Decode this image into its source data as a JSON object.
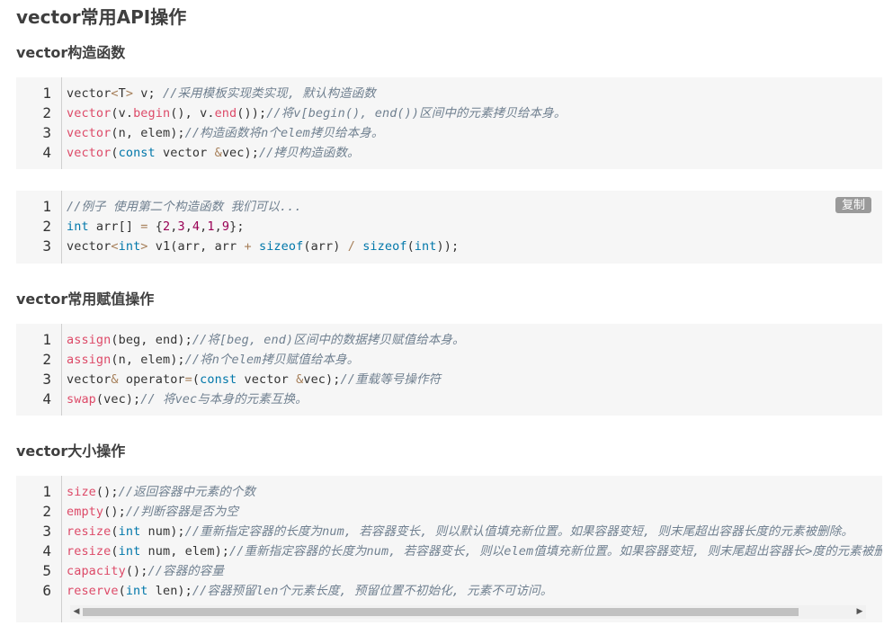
{
  "title": "vector常用API操作",
  "sections": [
    {
      "heading": "vector构造函数"
    },
    {
      "heading": "vector常用赋值操作"
    },
    {
      "heading": "vector大小操作"
    }
  ],
  "copy_label": "复制",
  "blocks": {
    "ctor": [
      {
        "num": "1",
        "tokens": [
          [
            "pl",
            "vector"
          ],
          [
            "op",
            "<"
          ],
          [
            "pl",
            "T"
          ],
          [
            "op",
            ">"
          ],
          [
            "pl",
            " v; "
          ],
          [
            "cm",
            "//采用模板实现类实现, 默认构造函数"
          ]
        ]
      },
      {
        "num": "2",
        "tokens": [
          [
            "fn",
            "vector"
          ],
          [
            "pl",
            "(v."
          ],
          [
            "fn",
            "begin"
          ],
          [
            "pl",
            "(), v."
          ],
          [
            "fn",
            "end"
          ],
          [
            "pl",
            "());"
          ],
          [
            "cm",
            "//将v[begin(), end())区间中的元素拷贝给本身。"
          ]
        ]
      },
      {
        "num": "3",
        "tokens": [
          [
            "fn",
            "vector"
          ],
          [
            "pl",
            "(n, elem);"
          ],
          [
            "cm",
            "//构造函数将n个elem拷贝给本身。"
          ]
        ]
      },
      {
        "num": "4",
        "tokens": [
          [
            "fn",
            "vector"
          ],
          [
            "pl",
            "("
          ],
          [
            "kw",
            "const"
          ],
          [
            "pl",
            " vector "
          ],
          [
            "op",
            "&"
          ],
          [
            "pl",
            "vec);"
          ],
          [
            "cm",
            "//拷贝构造函数。"
          ]
        ]
      }
    ],
    "example": [
      {
        "num": "1",
        "tokens": [
          [
            "cm",
            "//例子 使用第二个构造函数 我们可以..."
          ]
        ]
      },
      {
        "num": "2",
        "tokens": [
          [
            "kw",
            "int"
          ],
          [
            "pl",
            " arr[] "
          ],
          [
            "op",
            "="
          ],
          [
            "pl",
            " {"
          ],
          [
            "num",
            "2"
          ],
          [
            "pl",
            ","
          ],
          [
            "num",
            "3"
          ],
          [
            "pl",
            ","
          ],
          [
            "num",
            "4"
          ],
          [
            "pl",
            ","
          ],
          [
            "num",
            "1"
          ],
          [
            "pl",
            ","
          ],
          [
            "num",
            "9"
          ],
          [
            "pl",
            "};"
          ]
        ]
      },
      {
        "num": "3",
        "tokens": [
          [
            "pl",
            "vector"
          ],
          [
            "op",
            "<"
          ],
          [
            "kw",
            "int"
          ],
          [
            "op",
            ">"
          ],
          [
            "pl",
            " v1(arr, arr "
          ],
          [
            "op",
            "+"
          ],
          [
            "pl",
            " "
          ],
          [
            "kw",
            "sizeof"
          ],
          [
            "pl",
            "(arr) "
          ],
          [
            "op",
            "/"
          ],
          [
            "pl",
            " "
          ],
          [
            "kw",
            "sizeof"
          ],
          [
            "pl",
            "("
          ],
          [
            "kw",
            "int"
          ],
          [
            "pl",
            "));"
          ]
        ]
      }
    ],
    "assign": [
      {
        "num": "1",
        "tokens": [
          [
            "fn",
            "assign"
          ],
          [
            "pl",
            "(beg, end);"
          ],
          [
            "cm",
            "//将[beg, end)区间中的数据拷贝赋值给本身。"
          ]
        ]
      },
      {
        "num": "2",
        "tokens": [
          [
            "fn",
            "assign"
          ],
          [
            "pl",
            "(n, elem);"
          ],
          [
            "cm",
            "//将n个elem拷贝赋值给本身。"
          ]
        ]
      },
      {
        "num": "3",
        "tokens": [
          [
            "pl",
            "vector"
          ],
          [
            "op",
            "&"
          ],
          [
            "pl",
            " operator"
          ],
          [
            "op",
            "="
          ],
          [
            "pl",
            "("
          ],
          [
            "kw",
            "const"
          ],
          [
            "pl",
            " vector  "
          ],
          [
            "op",
            "&"
          ],
          [
            "pl",
            "vec);"
          ],
          [
            "cm",
            "//重载等号操作符"
          ]
        ]
      },
      {
        "num": "4",
        "tokens": [
          [
            "fn",
            "swap"
          ],
          [
            "pl",
            "(vec);"
          ],
          [
            "cm",
            "// 将vec与本身的元素互换。"
          ]
        ]
      }
    ],
    "size": [
      {
        "num": "1",
        "tokens": [
          [
            "fn",
            "size"
          ],
          [
            "pl",
            "();"
          ],
          [
            "cm",
            "//返回容器中元素的个数"
          ]
        ]
      },
      {
        "num": "2",
        "tokens": [
          [
            "fn",
            "empty"
          ],
          [
            "pl",
            "();"
          ],
          [
            "cm",
            "//判断容器是否为空"
          ]
        ]
      },
      {
        "num": "3",
        "tokens": [
          [
            "fn",
            "resize"
          ],
          [
            "pl",
            "("
          ],
          [
            "kw",
            "int"
          ],
          [
            "pl",
            " num);"
          ],
          [
            "cm",
            "//重新指定容器的长度为num, 若容器变长, 则以默认值填充新位置。如果容器变短, 则末尾超出容器长度的元素被删除。"
          ]
        ]
      },
      {
        "num": "4",
        "tokens": [
          [
            "fn",
            "resize"
          ],
          [
            "pl",
            "("
          ],
          [
            "kw",
            "int"
          ],
          [
            "pl",
            " num, elem);"
          ],
          [
            "cm",
            "//重新指定容器的长度为num, 若容器变长, 则以elem值填充新位置。如果容器变短, 则末尾超出容器长>度的元素被删除。"
          ]
        ]
      },
      {
        "num": "5",
        "tokens": [
          [
            "fn",
            "capacity"
          ],
          [
            "pl",
            "();"
          ],
          [
            "cm",
            "//容器的容量"
          ]
        ]
      },
      {
        "num": "6",
        "tokens": [
          [
            "fn",
            "reserve"
          ],
          [
            "pl",
            "("
          ],
          [
            "kw",
            "int"
          ],
          [
            "pl",
            " len);"
          ],
          [
            "cm",
            "//容器预留len个元素长度, 预留位置不初始化, 元素不可访问。"
          ]
        ]
      }
    ]
  },
  "scrollbar": {
    "left_icon": "◀",
    "right_icon": "▶"
  }
}
